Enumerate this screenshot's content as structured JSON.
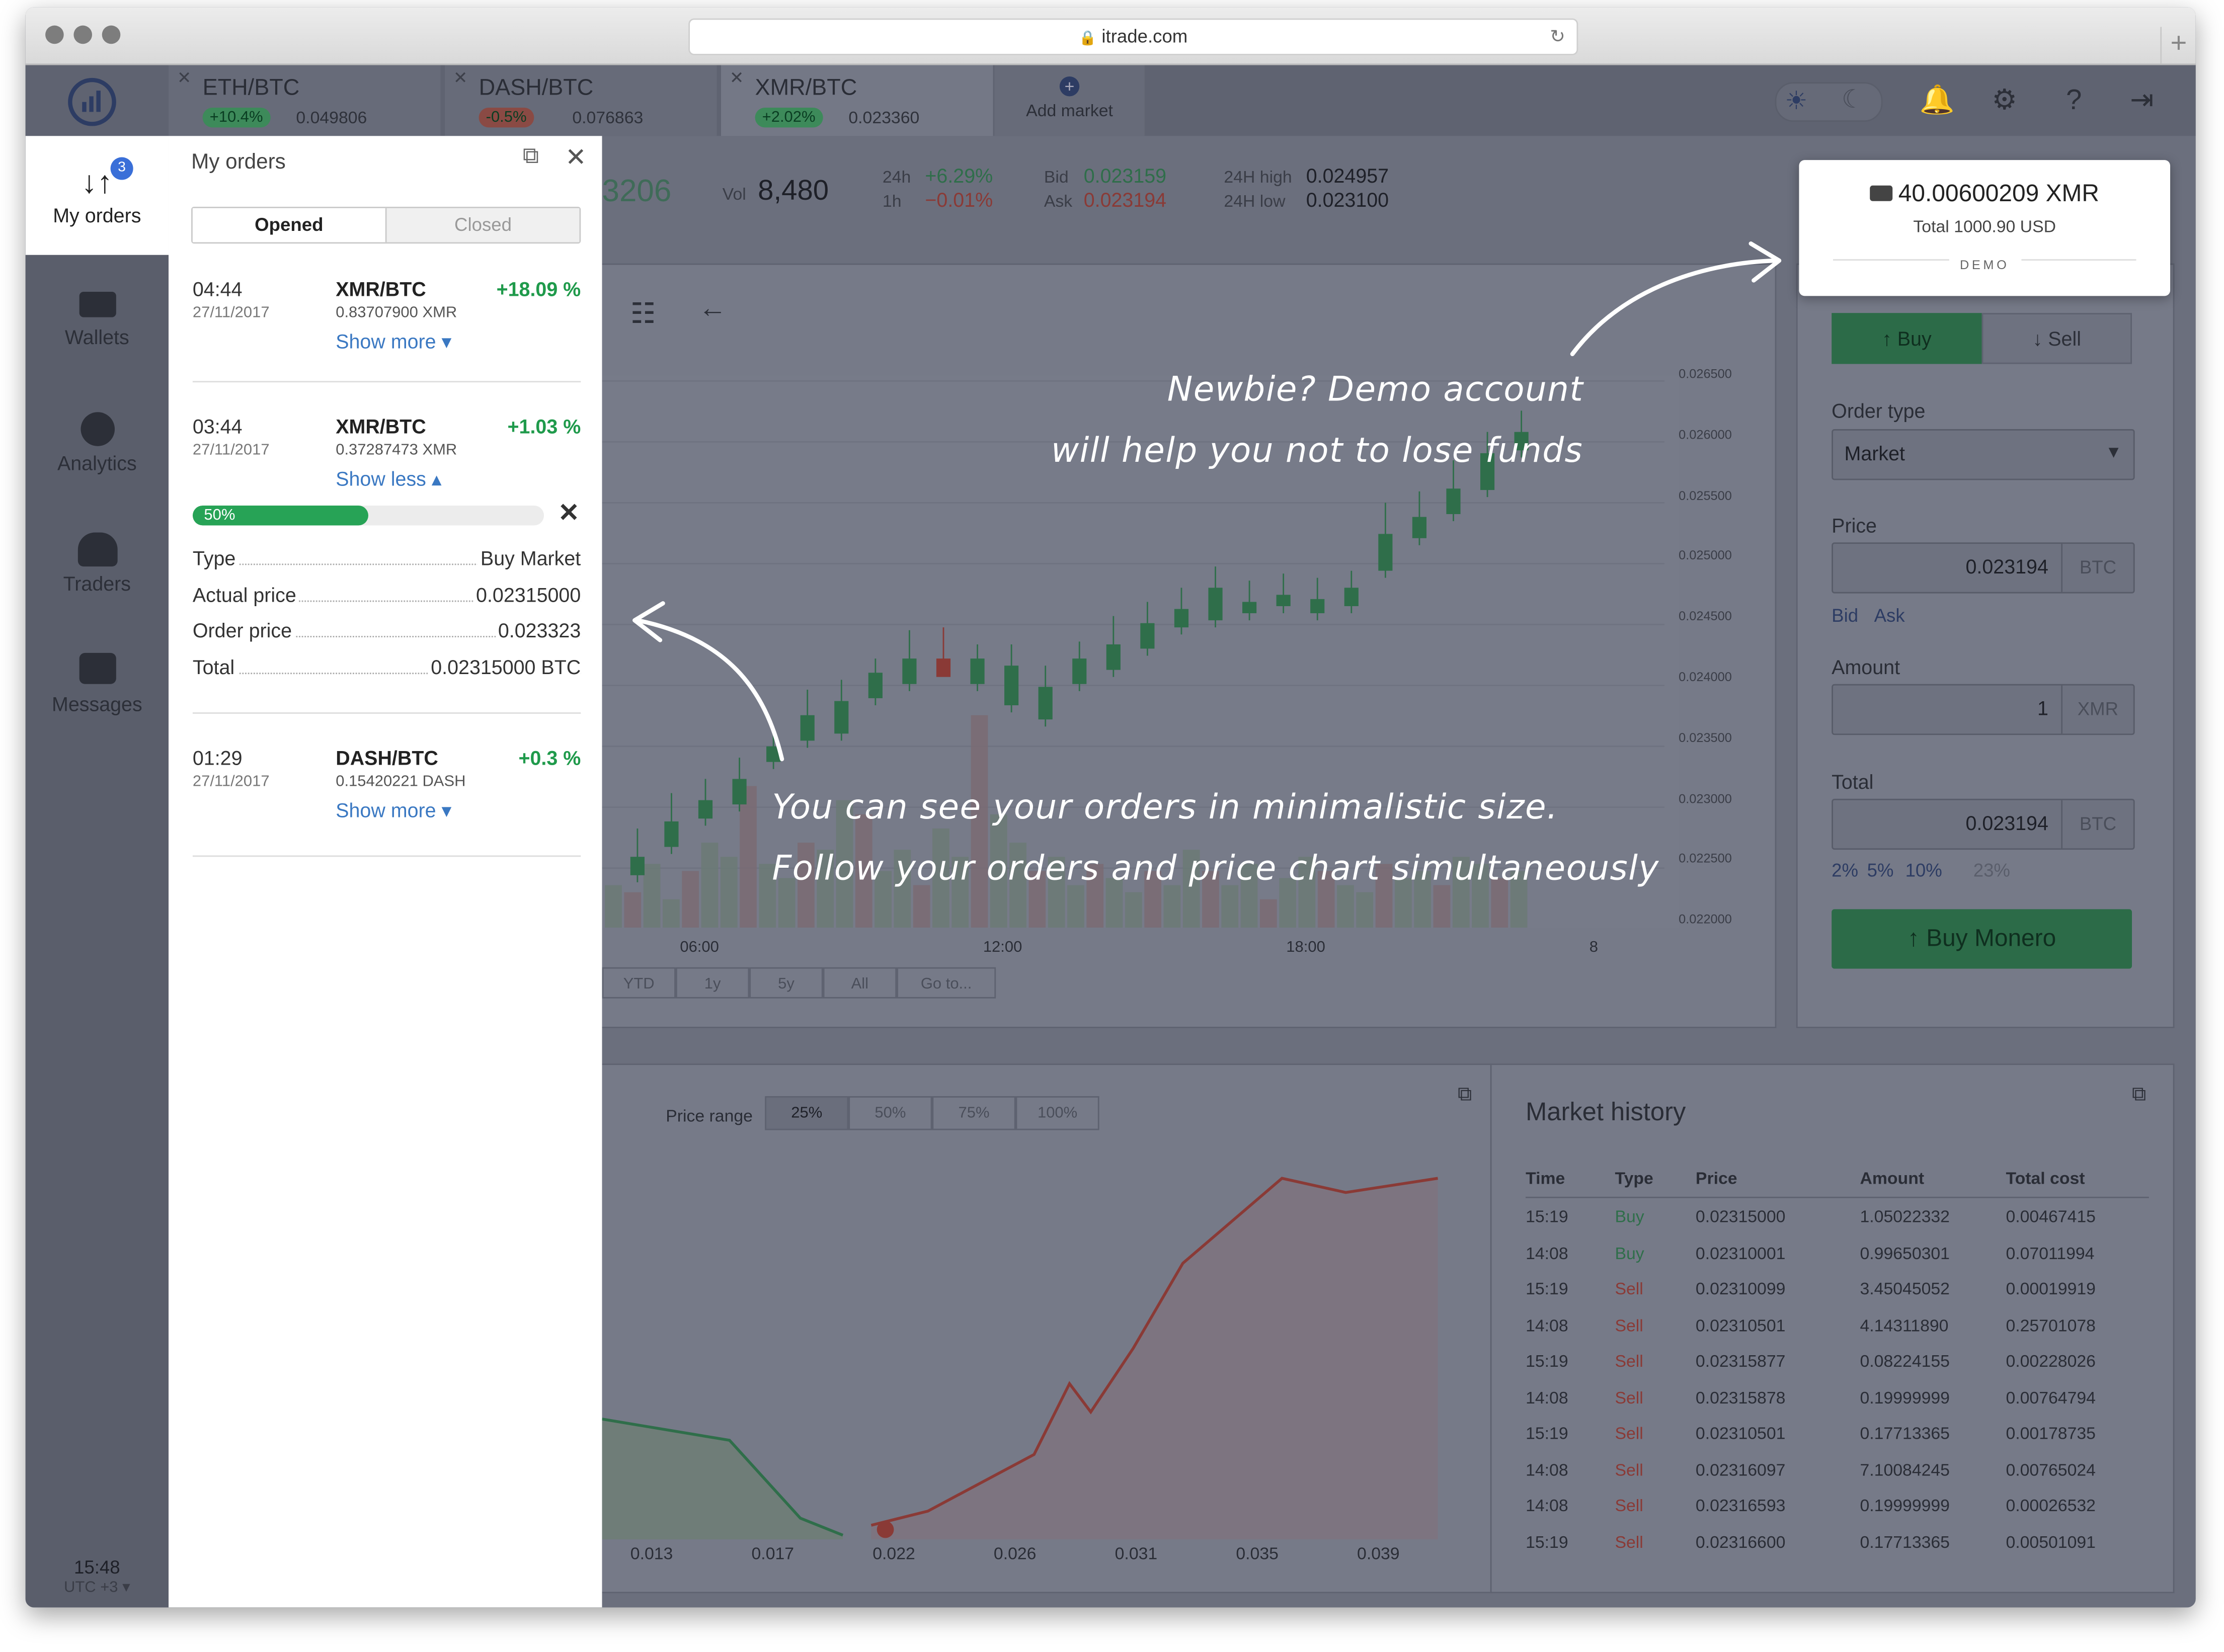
{
  "browser": {
    "url": "itrade.com"
  },
  "markets": [
    {
      "pair": "ETH/BTC",
      "change": "+10.4%",
      "price": "0.049806",
      "positive": true
    },
    {
      "pair": "DASH/BTC",
      "change": "-0.5%",
      "price": "0.076863",
      "positive": false
    },
    {
      "pair": "XMR/BTC",
      "change": "+2.02%",
      "price": "0.023360",
      "positive": true
    }
  ],
  "add_market": "Add market",
  "sidebar": {
    "items": [
      {
        "label": "My orders",
        "badge": "3",
        "icon": "up-down-arrows-icon"
      },
      {
        "label": "Wallets",
        "icon": "wallet-icon"
      },
      {
        "label": "Analytics",
        "icon": "pie-chart-icon"
      },
      {
        "label": "Traders",
        "icon": "users-icon"
      },
      {
        "label": "Messages",
        "icon": "chat-bubble-icon"
      }
    ],
    "clock": "15:48",
    "timezone": "UTC +3 ▾"
  },
  "orders_panel": {
    "title": "My orders",
    "tabs": [
      "Opened",
      "Closed"
    ],
    "active_tab": "Opened",
    "orders": [
      {
        "time": "04:44",
        "date": "27/11/2017",
        "pair": "XMR/BTC",
        "amount": "0.83707900 XMR",
        "change": "+18.09 %",
        "toggle": "Show more ▾"
      },
      {
        "time": "03:44",
        "date": "27/11/2017",
        "pair": "XMR/BTC",
        "amount": "0.37287473 XMR",
        "change": "+1.03 %",
        "toggle": "Show less ▴",
        "progress_label": "50%",
        "progress": 0.5,
        "details": [
          {
            "label": "Type",
            "value": "Buy Market"
          },
          {
            "label": "Actual price",
            "value": "0.02315000"
          },
          {
            "label": "Order price",
            "value": "0.023323"
          },
          {
            "label": "Total",
            "value": "0.02315000 BTC"
          }
        ]
      },
      {
        "time": "01:29",
        "date": "27/11/2017",
        "pair": "DASH/BTC",
        "amount": "0.15420221 DASH",
        "change": "+0.3 %",
        "toggle": "Show more ▾"
      }
    ]
  },
  "stats": {
    "last": "3206",
    "vol_label": "Vol",
    "vol": "8,480",
    "h24_label": "24h",
    "h24": "+6.29%",
    "h1_label": "1h",
    "h1": "−0.01%",
    "bid_label": "Bid",
    "bid": "0.023159",
    "ask_label": "Ask",
    "ask": "0.023194",
    "high_label": "24H high",
    "high": "0.024957",
    "low_label": "24H low",
    "low": "0.023100"
  },
  "price_axis": [
    "0.026500",
    "0.026000",
    "0.025500",
    "0.025000",
    "0.024500",
    "0.024000",
    "0.023500",
    "0.023000",
    "0.022500",
    "0.022000"
  ],
  "time_axis": [
    "06:00",
    "12:00",
    "18:00",
    "8"
  ],
  "range_buttons": [
    "YTD",
    "1y",
    "5y",
    "All",
    "Go to..."
  ],
  "depth": {
    "price_range_label": "Price range",
    "ranges": [
      "25%",
      "50%",
      "75%",
      "100%"
    ],
    "x_axis": [
      "0.013",
      "0.017",
      "0.022",
      "0.026",
      "0.031",
      "0.035",
      "0.039"
    ]
  },
  "demo_card": {
    "balance": "40.00600209 XMR",
    "total": "Total 1000.90 USD",
    "tag": "DEMO"
  },
  "trade_form": {
    "buy": "↑ Buy",
    "sell": "↓ Sell",
    "order_type_label": "Order type",
    "order_type": "Market",
    "price_label": "Price",
    "price": "0.023194",
    "price_unit": "BTC",
    "bid": "Bid",
    "ask": "Ask",
    "amount_label": "Amount",
    "amount": "1",
    "amount_unit": "XMR",
    "total_label": "Total",
    "total": "0.023194",
    "total_unit": "BTC",
    "percents": [
      "2%",
      "5%",
      "10%",
      "23%"
    ],
    "submit": "Buy Monero"
  },
  "market_history": {
    "title": "Market history",
    "columns": [
      "Time",
      "Type",
      "Price",
      "Amount",
      "Total cost"
    ],
    "rows": [
      [
        "15:19",
        "Buy",
        "0.02315000",
        "1.05022332",
        "0.00467415"
      ],
      [
        "14:08",
        "Buy",
        "0.02310001",
        "0.99650301",
        "0.07011994"
      ],
      [
        "15:19",
        "Sell",
        "0.02310099",
        "3.45045052",
        "0.00019919"
      ],
      [
        "14:08",
        "Sell",
        "0.02310501",
        "4.14311890",
        "0.25701078"
      ],
      [
        "15:19",
        "Sell",
        "0.02315877",
        "0.08224155",
        "0.00228026"
      ],
      [
        "14:08",
        "Sell",
        "0.02315878",
        "0.19999999",
        "0.00764794"
      ],
      [
        "15:19",
        "Sell",
        "0.02310501",
        "0.17713365",
        "0.00178735"
      ],
      [
        "14:08",
        "Sell",
        "0.02316097",
        "7.10084245",
        "0.00765024"
      ],
      [
        "14:08",
        "Sell",
        "0.02316593",
        "0.19999999",
        "0.00026532"
      ],
      [
        "15:19",
        "Sell",
        "0.02316600",
        "0.17713365",
        "0.00501091"
      ]
    ]
  },
  "callouts": {
    "demo_line1": "Newbie? Demo account",
    "demo_line2": "will help you not to lose funds",
    "orders_line1": "You can see your orders in minimalistic size.",
    "orders_line2": "Follow your orders and price chart simultaneously"
  },
  "colors": {
    "up": "#1f9a4b",
    "down": "#c0392b",
    "link": "#3a78c2",
    "overlay": "#6b6f7d"
  }
}
